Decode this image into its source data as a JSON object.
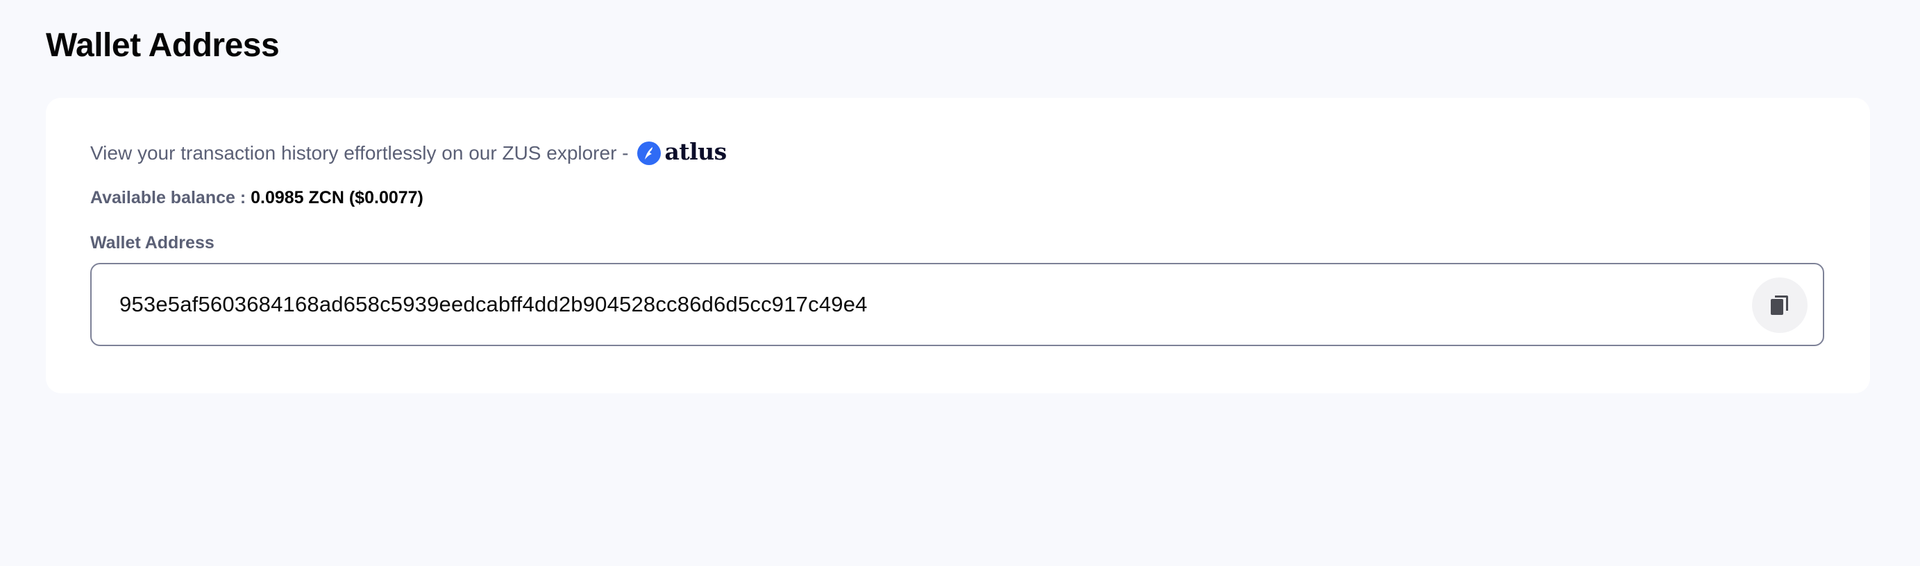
{
  "page": {
    "title": "Wallet Address"
  },
  "explorer": {
    "text": "View your transaction history effortlessly on our ZUS explorer -",
    "link_label": "atlus",
    "logo_icon": "atlus-logo-icon"
  },
  "balance": {
    "label": "Available balance :",
    "value": "0.0985 ZCN ($0.0077)"
  },
  "wallet": {
    "label": "Wallet Address",
    "address": "953e5af5603684168ad658c5939eedcabff4dd2b904528cc86d6d5cc917c49e4",
    "copy_icon": "copy-icon"
  },
  "colors": {
    "background": "#f8f9fd",
    "card": "#ffffff",
    "muted_text": "#5b6076",
    "border": "#7d8197",
    "accent_blue": "#2f6bf5"
  }
}
